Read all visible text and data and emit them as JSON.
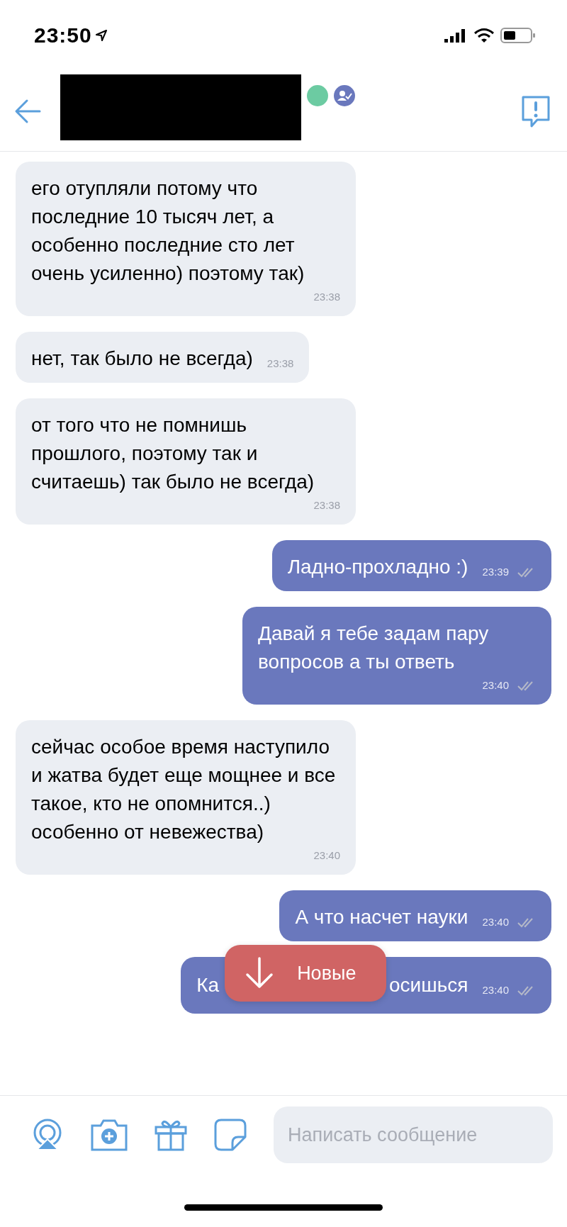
{
  "status_bar": {
    "time": "23:50"
  },
  "header": {
    "online": true,
    "verified": true
  },
  "messages": [
    {
      "kind": "incoming",
      "text": "его отупляли потому что последние 10 тысяч лет, а особенно последние сто лет очень усиленно) поэтому так)",
      "time": "23:38"
    },
    {
      "kind": "incoming",
      "text": "нет, так было не всегда)",
      "time": "23:38"
    },
    {
      "kind": "incoming",
      "text": "от того что не помнишь прошлого, поэтому так и считаешь) так было не всегда)",
      "time": "23:38"
    },
    {
      "kind": "outgoing",
      "text": "Ладно-прохладно :)",
      "time": "23:39",
      "read": true
    },
    {
      "kind": "outgoing",
      "text": "Давай я тебе задам пару вопросов а ты ответь",
      "time": "23:40",
      "read": true
    },
    {
      "kind": "incoming",
      "text": "сейчас особое время наступило и жатва будет еще мощнее и все такое, кто не опомнится..) особенно от невежества)",
      "time": "23:40"
    },
    {
      "kind": "outgoing",
      "text": "А что насчет науки",
      "time": "23:40",
      "read": true
    },
    {
      "kind": "outgoing",
      "text_start": "Ка",
      "text_end": "осишься",
      "time": "23:40",
      "read": true,
      "covered": true
    }
  ],
  "new_badge": {
    "label": "Новые"
  },
  "composer": {
    "placeholder": "Написать сообщение"
  }
}
